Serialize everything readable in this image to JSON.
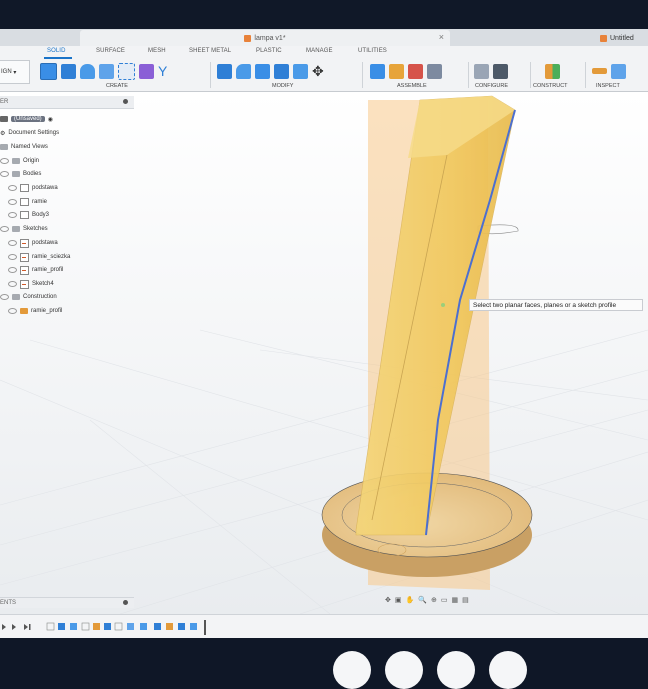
{
  "title_tab": {
    "name": "lampa v1*",
    "second_tab": "Untitled"
  },
  "ribbon": {
    "tabs": [
      "SOLID",
      "SURFACE",
      "MESH",
      "SHEET METAL",
      "PLASTIC",
      "MANAGE",
      "UTILITIES"
    ],
    "active_tab": "SOLID",
    "design_label": "IGN",
    "groups": [
      "CREATE",
      "MODIFY",
      "ASSEMBLE",
      "CONFIGURE",
      "CONSTRUCT",
      "INSPECT"
    ]
  },
  "browser": {
    "header": "ER",
    "items": [
      {
        "label": "(Unsaved)"
      },
      {
        "label": "Document Settings"
      },
      {
        "label": "Named Views"
      },
      {
        "label": "Origin"
      },
      {
        "label": "Bodies"
      },
      {
        "label": "podstawa"
      },
      {
        "label": "ramie"
      },
      {
        "label": "Body3"
      },
      {
        "label": "Sketches"
      },
      {
        "label": "podstawa"
      },
      {
        "label": "ramie_sciezka"
      },
      {
        "label": "ramie_profil"
      },
      {
        "label": "Sketch4"
      },
      {
        "label": "Construction"
      },
      {
        "label": "ramie_profil"
      }
    ]
  },
  "comments": {
    "label": "ENTS"
  },
  "tooltip": {
    "text": "Select two planar faces, planes or a sketch profile"
  },
  "colors": {
    "accent": "#1a73c8",
    "body_yellow": "#f2cf6a",
    "wood": "#e9c98f",
    "edge_blue": "#4c6fd0"
  }
}
